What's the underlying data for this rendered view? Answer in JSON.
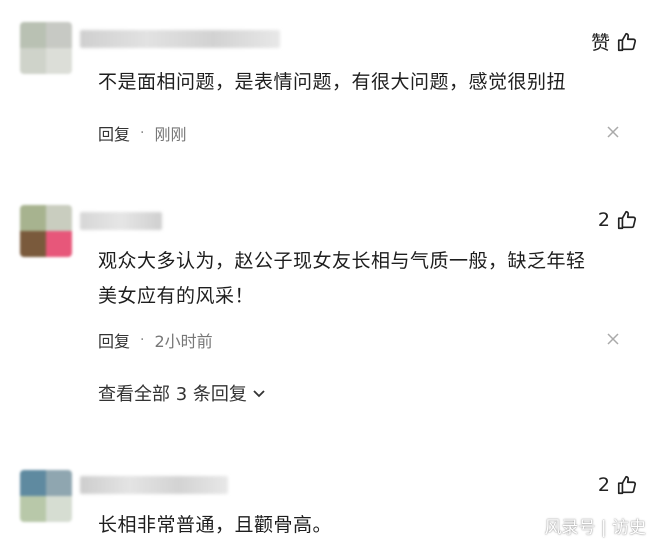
{
  "comments": [
    {
      "like_label": "赞",
      "text": "不是面相问题，是表情问题，有很大问题，感觉很别扭",
      "reply_label": "回复",
      "time": "刚刚"
    },
    {
      "like_count": "2",
      "text_lines": [
        "观众大多认为，赵公子现女友长相与气质一般，缺乏年轻",
        "美女应有的风采！"
      ],
      "reply_label": "回复",
      "time": "2小时前",
      "view_replies": "查看全部 3 条回复"
    },
    {
      "like_count": "2",
      "text": "长相非常普通，且颧骨高。"
    }
  ],
  "watermark": "风录号 | 访史",
  "colors": {
    "text": "#1e1e1e",
    "muted": "#777777",
    "close": "#aaaaaa"
  }
}
